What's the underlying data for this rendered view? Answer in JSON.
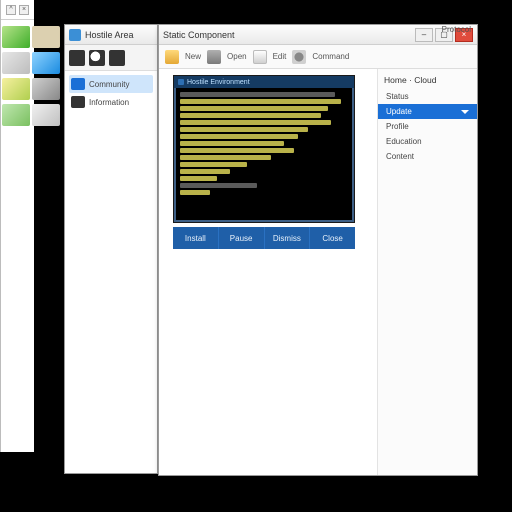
{
  "desktop": {
    "icons": [
      "a",
      "b",
      "c",
      "d",
      "e",
      "f",
      "g",
      "h"
    ]
  },
  "back_window": {
    "title": "Hostile Area",
    "items": [
      {
        "label": "Community",
        "selected": true
      },
      {
        "label": "Information",
        "selected": false
      }
    ]
  },
  "main_window": {
    "title": "Static Component",
    "ribbon": {
      "items": [
        "New",
        "Open",
        "Edit",
        "Command"
      ],
      "right_label": "Protocol"
    },
    "preview": {
      "header": "Hostile Environment",
      "line_widths_pct": [
        92,
        96,
        88,
        84,
        90,
        76,
        70,
        62,
        68,
        54,
        40,
        30,
        22,
        46,
        18
      ],
      "line_styles": [
        "g",
        "y",
        "y",
        "y",
        "y",
        "y",
        "y",
        "y",
        "y",
        "y",
        "y",
        "y",
        "y",
        "g",
        "y"
      ]
    },
    "buttons": [
      "Install",
      "Pause",
      "Dismiss",
      "Close"
    ],
    "sidepanel": {
      "heading": "Home · Cloud",
      "items": [
        {
          "label": "Status",
          "selected": false
        },
        {
          "label": "Update",
          "selected": true
        },
        {
          "label": "Profile",
          "selected": false
        },
        {
          "label": "Education",
          "selected": false
        },
        {
          "label": "Content",
          "selected": false
        }
      ]
    }
  },
  "edge_window": {
    "caret": "^",
    "x": "×"
  }
}
